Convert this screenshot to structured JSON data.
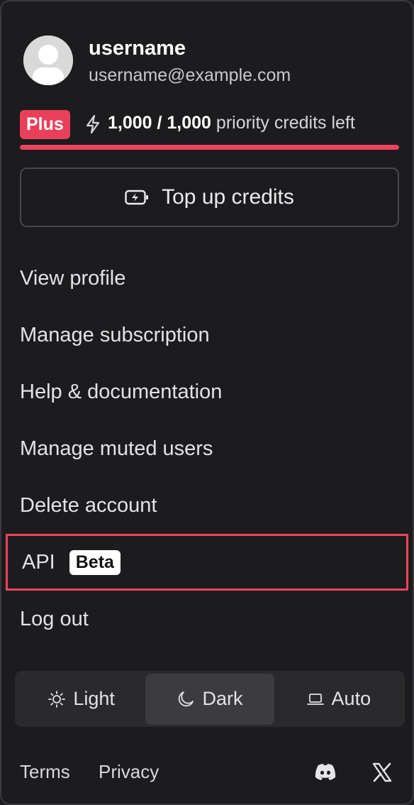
{
  "user": {
    "username": "username",
    "email": "username@example.com",
    "avatar_icon": "user-avatar-icon"
  },
  "credits": {
    "plan_badge": "Plus",
    "amount": "1,000 / 1,000",
    "suffix": "priority credits left",
    "remaining_fraction": 1.0,
    "bolt_icon": "lightning-bolt-icon"
  },
  "topup": {
    "label": "Top up credits",
    "icon": "battery-charging-icon"
  },
  "menu": {
    "view_profile": "View profile",
    "manage_subscription": "Manage subscription",
    "help_documentation": "Help & documentation",
    "manage_muted_users": "Manage muted users",
    "delete_account": "Delete account",
    "api": "API",
    "api_badge": "Beta",
    "log_out": "Log out"
  },
  "theme": {
    "light": "Light",
    "dark": "Dark",
    "auto": "Auto",
    "selected": "Dark"
  },
  "footer": {
    "terms": "Terms",
    "privacy": "Privacy",
    "discord_icon": "discord-icon",
    "x_icon": "x-icon"
  },
  "colors": {
    "background": "#1c1c1e",
    "accent": "#f0425c",
    "badge": "#e8405a"
  }
}
